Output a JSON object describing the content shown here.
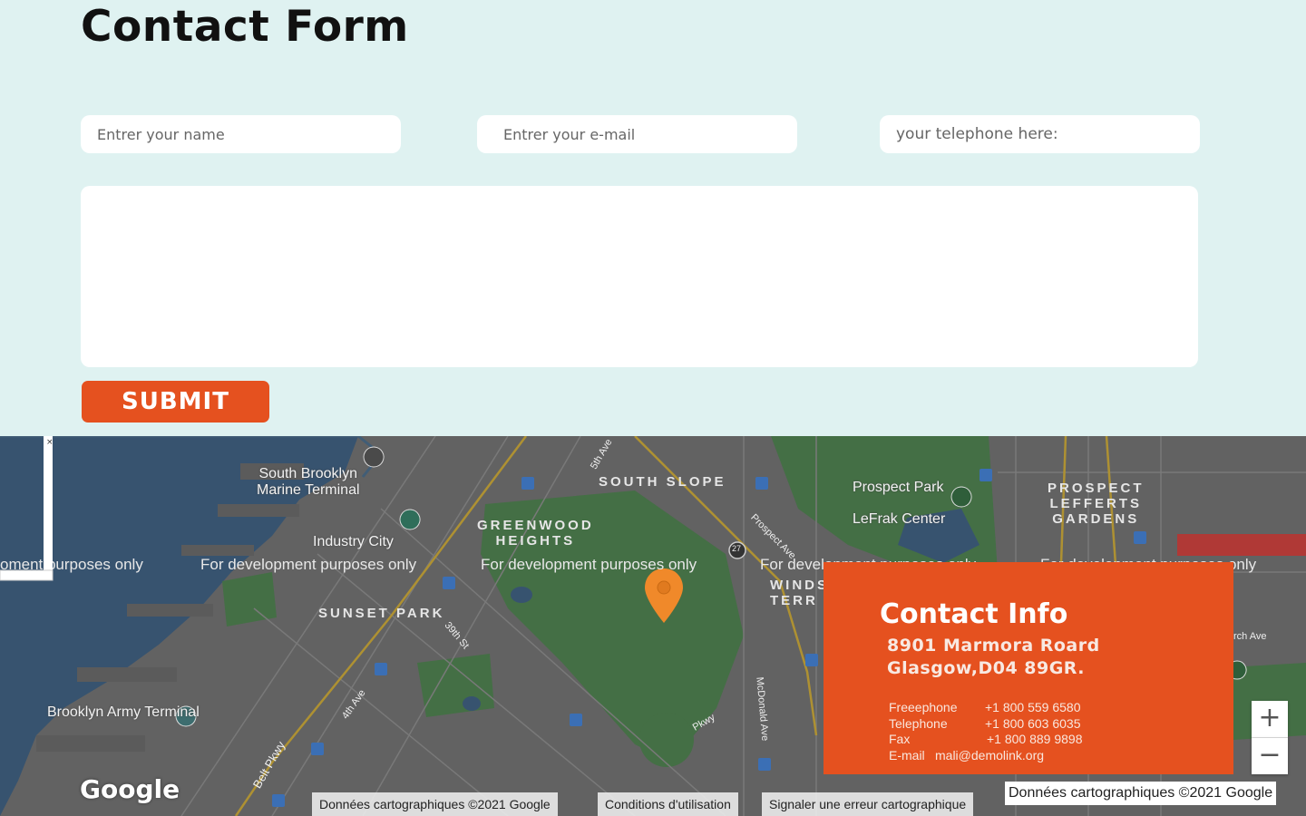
{
  "form": {
    "title": "Contact Form",
    "name_placeholder": "Entrer your name",
    "email_placeholder": "Entrer your e-mail",
    "tel_placeholder": "your telephone here:",
    "submit_label": "SUBMIT"
  },
  "map": {
    "labels": {
      "south_brooklyn": [
        "South Brooklyn",
        "Marine Terminal"
      ],
      "industry_city": "Industry City",
      "greenwood": [
        "GREENWOOD",
        "HEIGHTS"
      ],
      "south_slope": "SOUTH SLOPE",
      "prospect_park": "Prospect Park",
      "lefrak": "LeFrak Center",
      "prospect_lefferts": [
        "PROSPECT",
        "LEFFERTS",
        "GARDENS"
      ],
      "sunset_park": "SUNSET PARK",
      "windsor": [
        "WINDS",
        "TERR"
      ],
      "brooklyn_army": "Brooklyn Army Terminal",
      "dev_watermark": "For development purposes only",
      "dev_watermark_left": "oment purposes only",
      "street_39th": "39th St",
      "street_4th": "4th Ave",
      "street_5th": "5th Ave",
      "street_mcdonald": "McDonald Ave",
      "street_belt": "Belt Pkwy",
      "street_prospect": "Prospect Ave",
      "street_church": "rch Ave",
      "street_pkwy": "Pkwy",
      "route_27": "27"
    },
    "google_logo": "Google",
    "attribution": {
      "data": "Données cartographiques ©2021 Google",
      "terms": "Conditions d'utilisation",
      "report": "Signaler une erreur cartographique",
      "data_right": "Données cartographiques ©2021 Google"
    },
    "zoom_in": "+",
    "zoom_out": "−"
  },
  "contact_info": {
    "title": "Contact Info",
    "address_line1": "8901  Marmora Roard",
    "address_line2": "Glasgow,D04 89GR.",
    "rows": [
      {
        "label": "Freeephone",
        "value": "+1 800 559 6580"
      },
      {
        "label": "Telephone",
        "value": "+1 800 603 6035"
      },
      {
        "label": "Fax",
        "value": "+1 800 889 9898"
      },
      {
        "label": "E-mail",
        "value": "mali@demolink.org"
      }
    ]
  },
  "colors": {
    "accent": "#e5511f",
    "form_bg": "#dff2f1",
    "map_water": "#3f5f7f",
    "map_park": "#4e7f4f",
    "pin": "#f0892a"
  }
}
